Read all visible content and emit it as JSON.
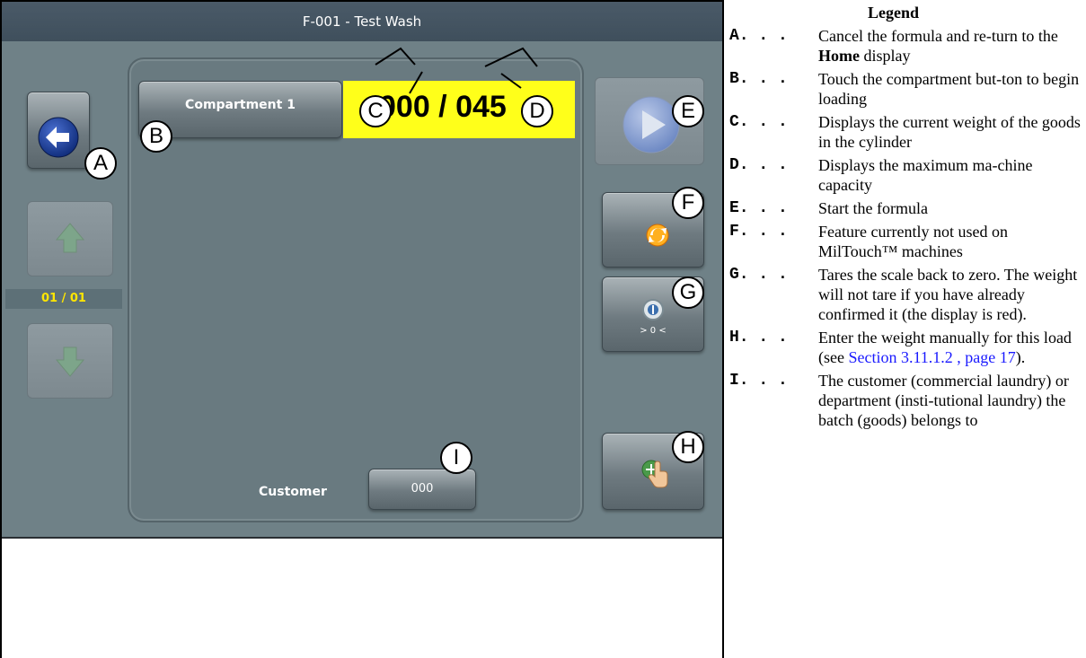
{
  "screen": {
    "title": "F-001 - Test Wash",
    "compartment_label": "Compartment  1",
    "weight_current": "000",
    "weight_sep": " / ",
    "weight_max": "045",
    "page_indicator": "01 / 01",
    "customer_label": "Customer",
    "customer_value": "000",
    "tare_label": "> 0 <"
  },
  "callouts": [
    "A",
    "B",
    "C",
    "D",
    "E",
    "F",
    "G",
    "H",
    "I"
  ],
  "legend": {
    "title": "Legend",
    "items": [
      {
        "key": "A. . .",
        "text": "Cancel the formula and re-turn to the ",
        "bold": "Home",
        "after": " display"
      },
      {
        "key": "B. . .",
        "text": "Touch the compartment but-ton to begin loading"
      },
      {
        "key": "C. . .",
        "text": "Displays the current weight of the goods in the cylinder"
      },
      {
        "key": "D. . .",
        "text": "Displays the maximum ma-chine capacity"
      },
      {
        "key": "E. . .",
        "text": "Start the formula"
      },
      {
        "key": "F. . .",
        "text": "Feature currently not used on MilTouch™ machines"
      },
      {
        "key": "G. . .",
        "text": "Tares the scale back to zero. The weight will not tare if you have already confirmed it (the display is red)."
      },
      {
        "key": "H. . .",
        "text": "Enter the weight manually for this load (see ",
        "link": "Section 3.11.1.2 , page 17",
        "after": ")."
      },
      {
        "key": "I. . .",
        "text": "The customer (commercial laundry) or department (insti-tutional laundry) the batch (goods) belongs to"
      }
    ]
  },
  "colors": {
    "screen_bg": "#6f8187",
    "weight_bg": "#ffff1a",
    "page_indicator": "#ffe600",
    "link": "#1a1aff"
  },
  "icons": [
    "back-arrow-icon",
    "up-arrow-icon",
    "down-arrow-icon",
    "play-icon",
    "refresh-icon",
    "tare-icon",
    "manual-entry-hand-icon"
  ]
}
